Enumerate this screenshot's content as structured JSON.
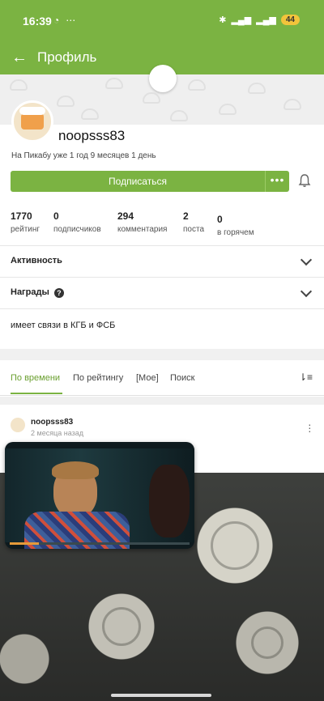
{
  "status_bar": {
    "time": "16:39",
    "left_icons": [
      "whatsapp-icon",
      "more-icon"
    ],
    "battery": "44"
  },
  "app_bar": {
    "title": "Профиль"
  },
  "profile": {
    "username": "noopsss83",
    "since": "На Пикабу уже 1 год 9 месяцев 1 день",
    "subscribe_label": "Подписаться"
  },
  "stats": [
    {
      "value": "1770",
      "label": "рейтинг"
    },
    {
      "value": "0",
      "label": "подписчиков"
    },
    {
      "value": "294",
      "label": "комментария"
    },
    {
      "value": "2",
      "label": "поста"
    },
    {
      "value": "0",
      "label": "в горячем"
    }
  ],
  "sections": {
    "activity": "Активность",
    "awards": "Награды",
    "about": "имеет связи в КГБ и ФСБ"
  },
  "tabs": [
    {
      "label": "По времени",
      "active": true
    },
    {
      "label": "По рейтингу",
      "active": false
    },
    {
      "label": "[Мое]",
      "active": false
    },
    {
      "label": "Поиск",
      "active": false
    }
  ],
  "post": {
    "author": "noopsss83",
    "time": "2 месяца назад"
  },
  "colors": {
    "accent": "#7bb342"
  }
}
